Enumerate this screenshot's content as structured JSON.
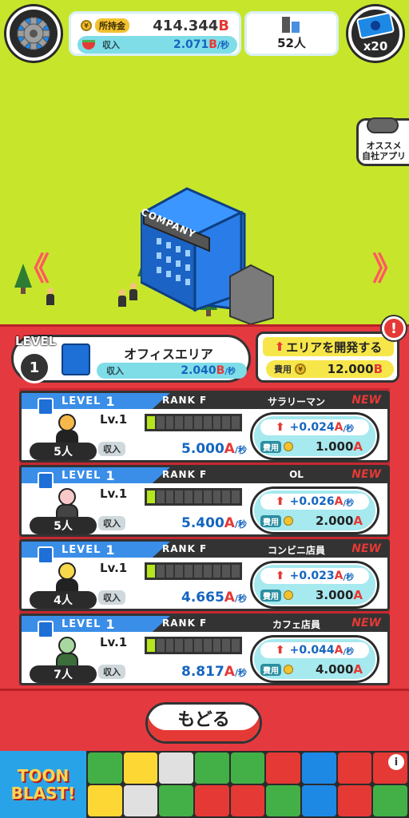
{
  "topbar": {
    "money_label": "所持金",
    "money_value": "414.344",
    "money_unit": "B",
    "income_label": "収入",
    "income_value": "2.071",
    "income_unit": "B",
    "income_per": "/秒",
    "staff_total": "52人",
    "ticket_count": "x20"
  },
  "side": {
    "recommended_line1": "オススメ",
    "recommended_line2": "自社アプリ"
  },
  "world": {
    "building_sign": "COMPANY",
    "left_arrow": "《",
    "right_arrow": "》"
  },
  "area": {
    "level_label": "LEVEL",
    "level_value": "1",
    "name": "オフィスエリア",
    "income_label": "収入",
    "income_value": "2.040",
    "income_unit": "B",
    "income_per": "/秒",
    "develop_label": "エリアを開発する",
    "cost_label": "費用",
    "cost_value": "12.000",
    "cost_unit": "B",
    "alert": "!"
  },
  "jobs": [
    {
      "level_label": "LEVEL",
      "level": "1",
      "rank": "RANK F",
      "name": "サラリーマン",
      "new": "NEW",
      "lv": "Lv.1",
      "progress": 1,
      "staff": "5人",
      "income_label": "収入",
      "income": "5.000",
      "income_unit": "A",
      "per": "/秒",
      "gain": "+0.024",
      "gain_unit": "A",
      "gain_per": "/秒",
      "cost_label": "費用",
      "cost": "1.000",
      "cost_unit": "A",
      "hair": "#222222",
      "head": "#f5b84a"
    },
    {
      "level_label": "LEVEL",
      "level": "1",
      "rank": "RANK F",
      "name": "OL",
      "new": "NEW",
      "lv": "Lv.1",
      "progress": 1,
      "staff": "5人",
      "income_label": "収入",
      "income": "5.400",
      "income_unit": "A",
      "per": "/秒",
      "gain": "+0.026",
      "gain_unit": "A",
      "gain_per": "/秒",
      "cost_label": "費用",
      "cost": "2.000",
      "cost_unit": "A",
      "hair": "#444444",
      "head": "#f8c8c8"
    },
    {
      "level_label": "LEVEL",
      "level": "1",
      "rank": "RANK F",
      "name": "コンビニ店員",
      "new": "NEW",
      "lv": "Lv.1",
      "progress": 1,
      "staff": "4人",
      "income_label": "収入",
      "income": "4.665",
      "income_unit": "A",
      "per": "/秒",
      "gain": "+0.023",
      "gain_unit": "A",
      "gain_per": "/秒",
      "cost_label": "費用",
      "cost": "3.000",
      "cost_unit": "A",
      "hair": "#222222",
      "head": "#f7d84a"
    },
    {
      "level_label": "LEVEL",
      "level": "1",
      "rank": "RANK F",
      "name": "カフェ店員",
      "new": "NEW",
      "lv": "Lv.1",
      "progress": 1,
      "staff": "7人",
      "income_label": "収入",
      "income": "8.817",
      "income_unit": "A",
      "per": "/秒",
      "gain": "+0.044",
      "gain_unit": "A",
      "gain_per": "/秒",
      "cost_label": "費用",
      "cost": "4.000",
      "cost_unit": "A",
      "hair": "#3b6e3b",
      "head": "#a8d8a0"
    }
  ],
  "bottom": {
    "back_label": "もどる"
  },
  "ad": {
    "logo_line1": "TOON",
    "logo_line2": "BLAST!",
    "info": "i"
  }
}
